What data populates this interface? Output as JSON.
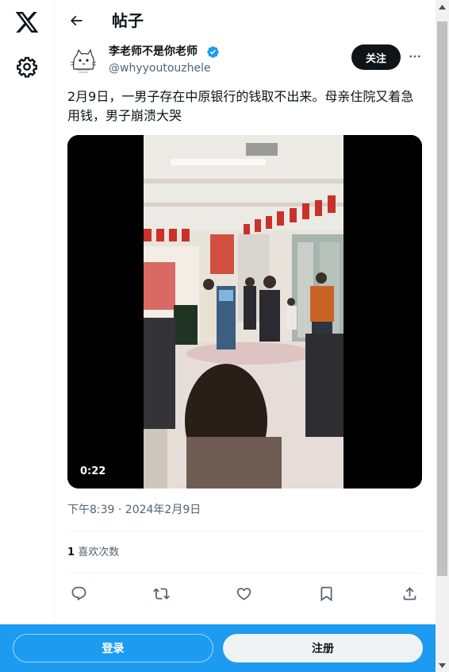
{
  "header": {
    "title": "帖子"
  },
  "post": {
    "author_name": "李老师不是你老师",
    "handle": "@whyyoutouzhele",
    "follow_label": "关注",
    "text": "2月9日，一男子存在中原银行的钱取不出来。母亲住院又着急用钱，男子崩溃大哭",
    "video_duration": "0:22",
    "timestamp": "下午8:39 · 2024年2月9日",
    "likes_count": "1",
    "likes_label": "喜欢次数"
  },
  "bottom_bar": {
    "login_label": "登录",
    "signup_label": "注册"
  },
  "colors": {
    "accent": "#1d9bf0",
    "text": "#0f1419",
    "muted": "#536471",
    "divider": "#eff3f4"
  },
  "icons": {
    "logo": "x-logo-icon",
    "settings": "gear-icon",
    "back": "arrow-left-icon",
    "verified": "verified-badge-icon",
    "more": "more-horizontal-icon",
    "reply": "reply-icon",
    "repost": "repost-icon",
    "like": "heart-icon",
    "bookmark": "bookmark-icon",
    "share": "share-icon"
  }
}
